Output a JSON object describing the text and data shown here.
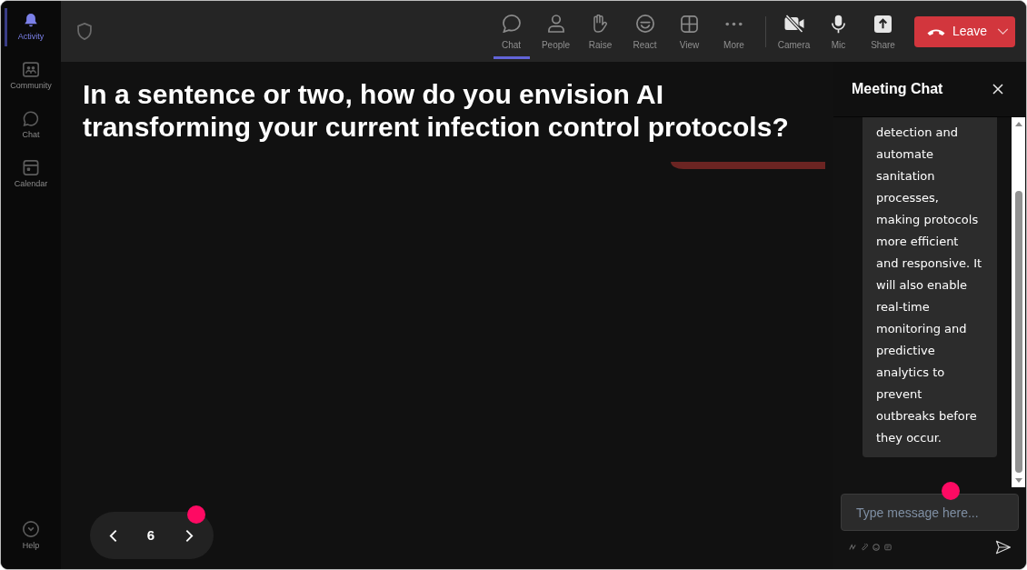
{
  "rail": {
    "items": [
      {
        "kind": "activity",
        "label": "Activity",
        "selected": true
      },
      {
        "kind": "community",
        "label": "Community",
        "selected": false
      },
      {
        "kind": "chat",
        "label": "Chat",
        "selected": false
      },
      {
        "kind": "calendar",
        "label": "Calendar",
        "selected": false
      }
    ],
    "help": {
      "label": "Help"
    }
  },
  "toolbar": {
    "items": [
      {
        "kind": "chat",
        "label": "Chat",
        "selected": true
      },
      {
        "kind": "people",
        "label": "People",
        "selected": false
      },
      {
        "kind": "raise",
        "label": "Raise",
        "selected": false
      },
      {
        "kind": "react",
        "label": "React",
        "selected": false
      },
      {
        "kind": "view",
        "label": "View",
        "selected": false
      },
      {
        "kind": "more",
        "label": "More",
        "selected": false
      }
    ],
    "devices": [
      {
        "kind": "camera",
        "label": "Camera",
        "on": false
      },
      {
        "kind": "mic",
        "label": "Mic",
        "on": true
      },
      {
        "kind": "share",
        "label": "Share"
      }
    ],
    "leave": {
      "label": "Leave"
    }
  },
  "stage": {
    "question": "In a sentence or two, how do you envision AI transforming your current infection control protocols?",
    "pager": {
      "page": "6"
    }
  },
  "chat_panel": {
    "title": "Meeting Chat",
    "messages": [
      {
        "text": "detection and automate sanitation processes, making protocols more efficient and responsive. It will also enable real-time monitoring and predictive analytics to prevent outbreaks before they occur."
      }
    ],
    "composer": {
      "placeholder": "Type message here..."
    }
  }
}
